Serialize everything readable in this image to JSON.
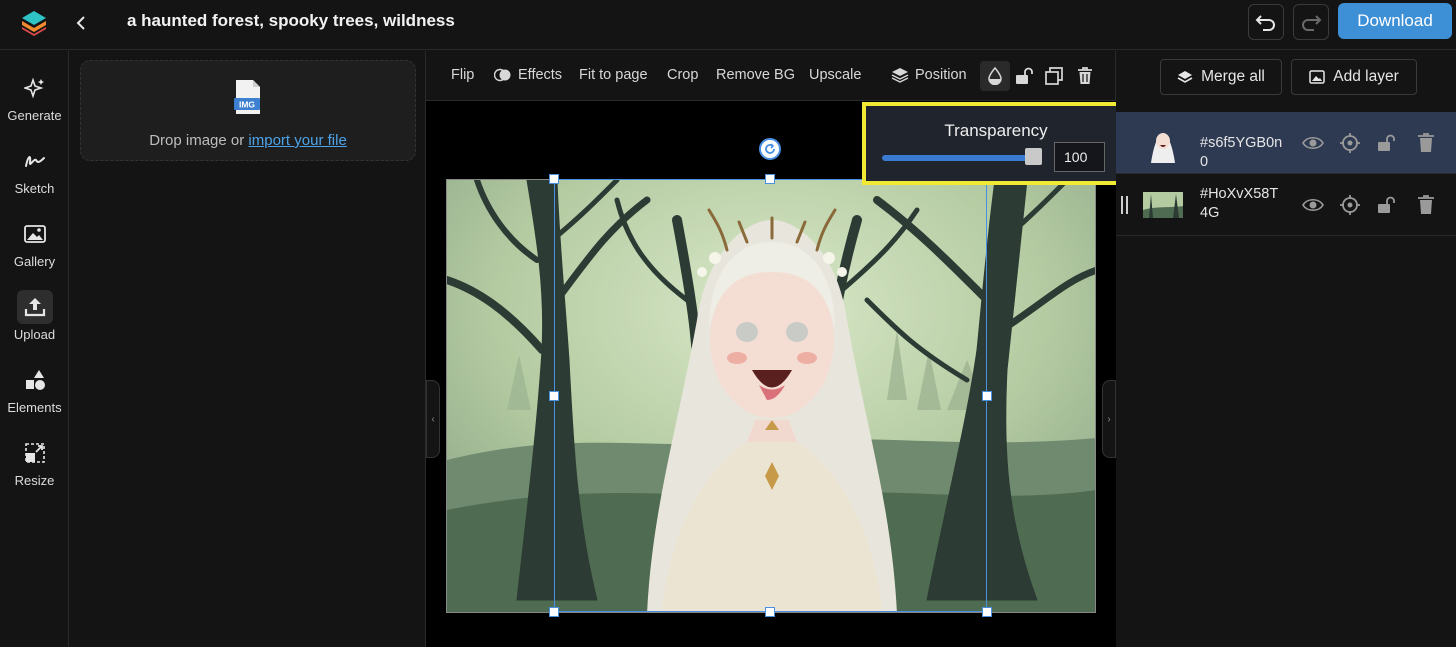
{
  "header": {
    "title": "a haunted forest, spooky trees, wildness",
    "download_label": "Download",
    "undo_icon": "undo-icon",
    "redo_icon": "redo-icon"
  },
  "sidebar": {
    "items": [
      {
        "label": "Generate",
        "icon": "sparkle-icon"
      },
      {
        "label": "Sketch",
        "icon": "squiggle-icon"
      },
      {
        "label": "Gallery",
        "icon": "image-icon"
      },
      {
        "label": "Upload",
        "icon": "upload-icon",
        "active": true
      },
      {
        "label": "Elements",
        "icon": "shapes-icon"
      },
      {
        "label": "Resize",
        "icon": "resize-icon"
      }
    ]
  },
  "upload_panel": {
    "badge": "IMG",
    "drop_text": "Drop image or ",
    "link_text": "import your file"
  },
  "toolbar": {
    "flip": "Flip",
    "effects": "Effects",
    "fit_to_page": "Fit to page",
    "crop": "Crop",
    "remove_bg": "Remove BG",
    "upscale": "Upscale",
    "position": "Position"
  },
  "transparency": {
    "title": "Transparency",
    "value": "100",
    "level": 1.0
  },
  "layers_panel": {
    "merge_all": "Merge all",
    "add_layer": "Add layer",
    "layers": [
      {
        "name": "#s6f5YGB0n0",
        "active": true
      },
      {
        "name": "#HoXvX58T4G",
        "active": false
      }
    ]
  },
  "colors": {
    "accent": "#3d8fd6",
    "highlight": "#f2e935",
    "active_layer": "#2e3a52",
    "selection": "#4a90e2"
  }
}
